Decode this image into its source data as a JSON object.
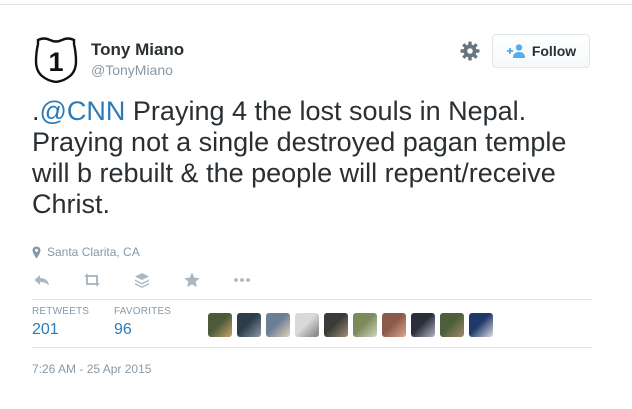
{
  "author": {
    "name": "Tony Miano",
    "handle": "@TonyMiano",
    "avatar_icon": "route-1-shield-icon",
    "avatar_text": "1"
  },
  "follow_button": {
    "label": "Follow",
    "icon": "add-user-icon"
  },
  "settings_icon": "gear-icon",
  "tweet": {
    "prefix": ".",
    "mention": "@CNN",
    "body": " Praying 4 the lost souls in Nepal. Praying not a single destroyed pagan temple will b rebuilt & the people will repent/receive Christ."
  },
  "location": {
    "icon": "map-pin-icon",
    "text": "Santa Clarita, CA"
  },
  "actions": [
    "reply-icon",
    "retweet-icon",
    "layers-icon",
    "star-icon",
    "more-icon"
  ],
  "stats": {
    "retweets_label": "RETWEETS",
    "retweets_count": "201",
    "favorites_label": "FAVORITES",
    "favorites_count": "96"
  },
  "favoriters": [
    {
      "colors": [
        "#4a5a3a",
        "#c7a26a"
      ]
    },
    {
      "colors": [
        "#2f3c4a",
        "#8a9aa8"
      ]
    },
    {
      "colors": [
        "#6a7e95",
        "#e8d2b8"
      ]
    },
    {
      "colors": [
        "#d9d9d9",
        "#7b7b7b"
      ]
    },
    {
      "colors": [
        "#3a3a3a",
        "#a58d74"
      ]
    },
    {
      "colors": [
        "#7d8a5a",
        "#cfd6bf"
      ]
    },
    {
      "colors": [
        "#8a5a4a",
        "#e0a48a"
      ]
    },
    {
      "colors": [
        "#2a2f3a",
        "#b0b8c4"
      ]
    },
    {
      "colors": [
        "#4a5f3a",
        "#a48a6a"
      ]
    },
    {
      "colors": [
        "#1f3a6a",
        "#dcdce0"
      ]
    }
  ],
  "timestamp": "7:26 AM - 25 Apr 2015",
  "colors": {
    "link": "#2b7bb9",
    "muted": "#8899a6",
    "text": "#292f33",
    "border": "#e1e8ed"
  }
}
